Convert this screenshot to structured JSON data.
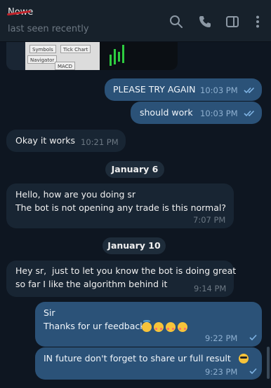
{
  "header": {
    "contact_name": "Nowe",
    "status": "last seen recently",
    "icons": [
      "search-icon",
      "phone-icon",
      "sidebar-toggle-icon",
      "more-vertical-icon"
    ]
  },
  "media_preview": {
    "tabs": [
      "Symbols",
      "Tick Chart",
      "Navigator",
      "MACD"
    ]
  },
  "messages": [
    {
      "direction": "out",
      "text": "PLEASE TRY AGAIN",
      "time": "10:03 PM",
      "status": "read"
    },
    {
      "direction": "out",
      "text": "should work",
      "time": "10:03 PM",
      "status": "read"
    },
    {
      "direction": "in",
      "text": "Okay it works",
      "time": "10:21 PM"
    },
    {
      "direction": "in",
      "text": "Hello, how are you doing sr\nThe bot is not opening any trade is this normal?",
      "time": "7:07 PM"
    },
    {
      "direction": "in",
      "text": "Hey sr,  just to let you know the bot is doing great\nso far I like the algorithm behind it",
      "time": "9:14 PM"
    },
    {
      "direction": "out",
      "text": "Sir\nThanks for ur feedback",
      "time": "9:22 PM",
      "status": "sent"
    },
    {
      "direction": "out",
      "text": "IN future don't forget to share ur full result",
      "time": "9:23 PM",
      "status": "sent"
    }
  ],
  "dates": [
    "January 6",
    "January 10"
  ],
  "colors": {
    "outgoing": "#2b5278",
    "incoming": "#182533",
    "background": "#0e1621",
    "header": "#17212b"
  }
}
